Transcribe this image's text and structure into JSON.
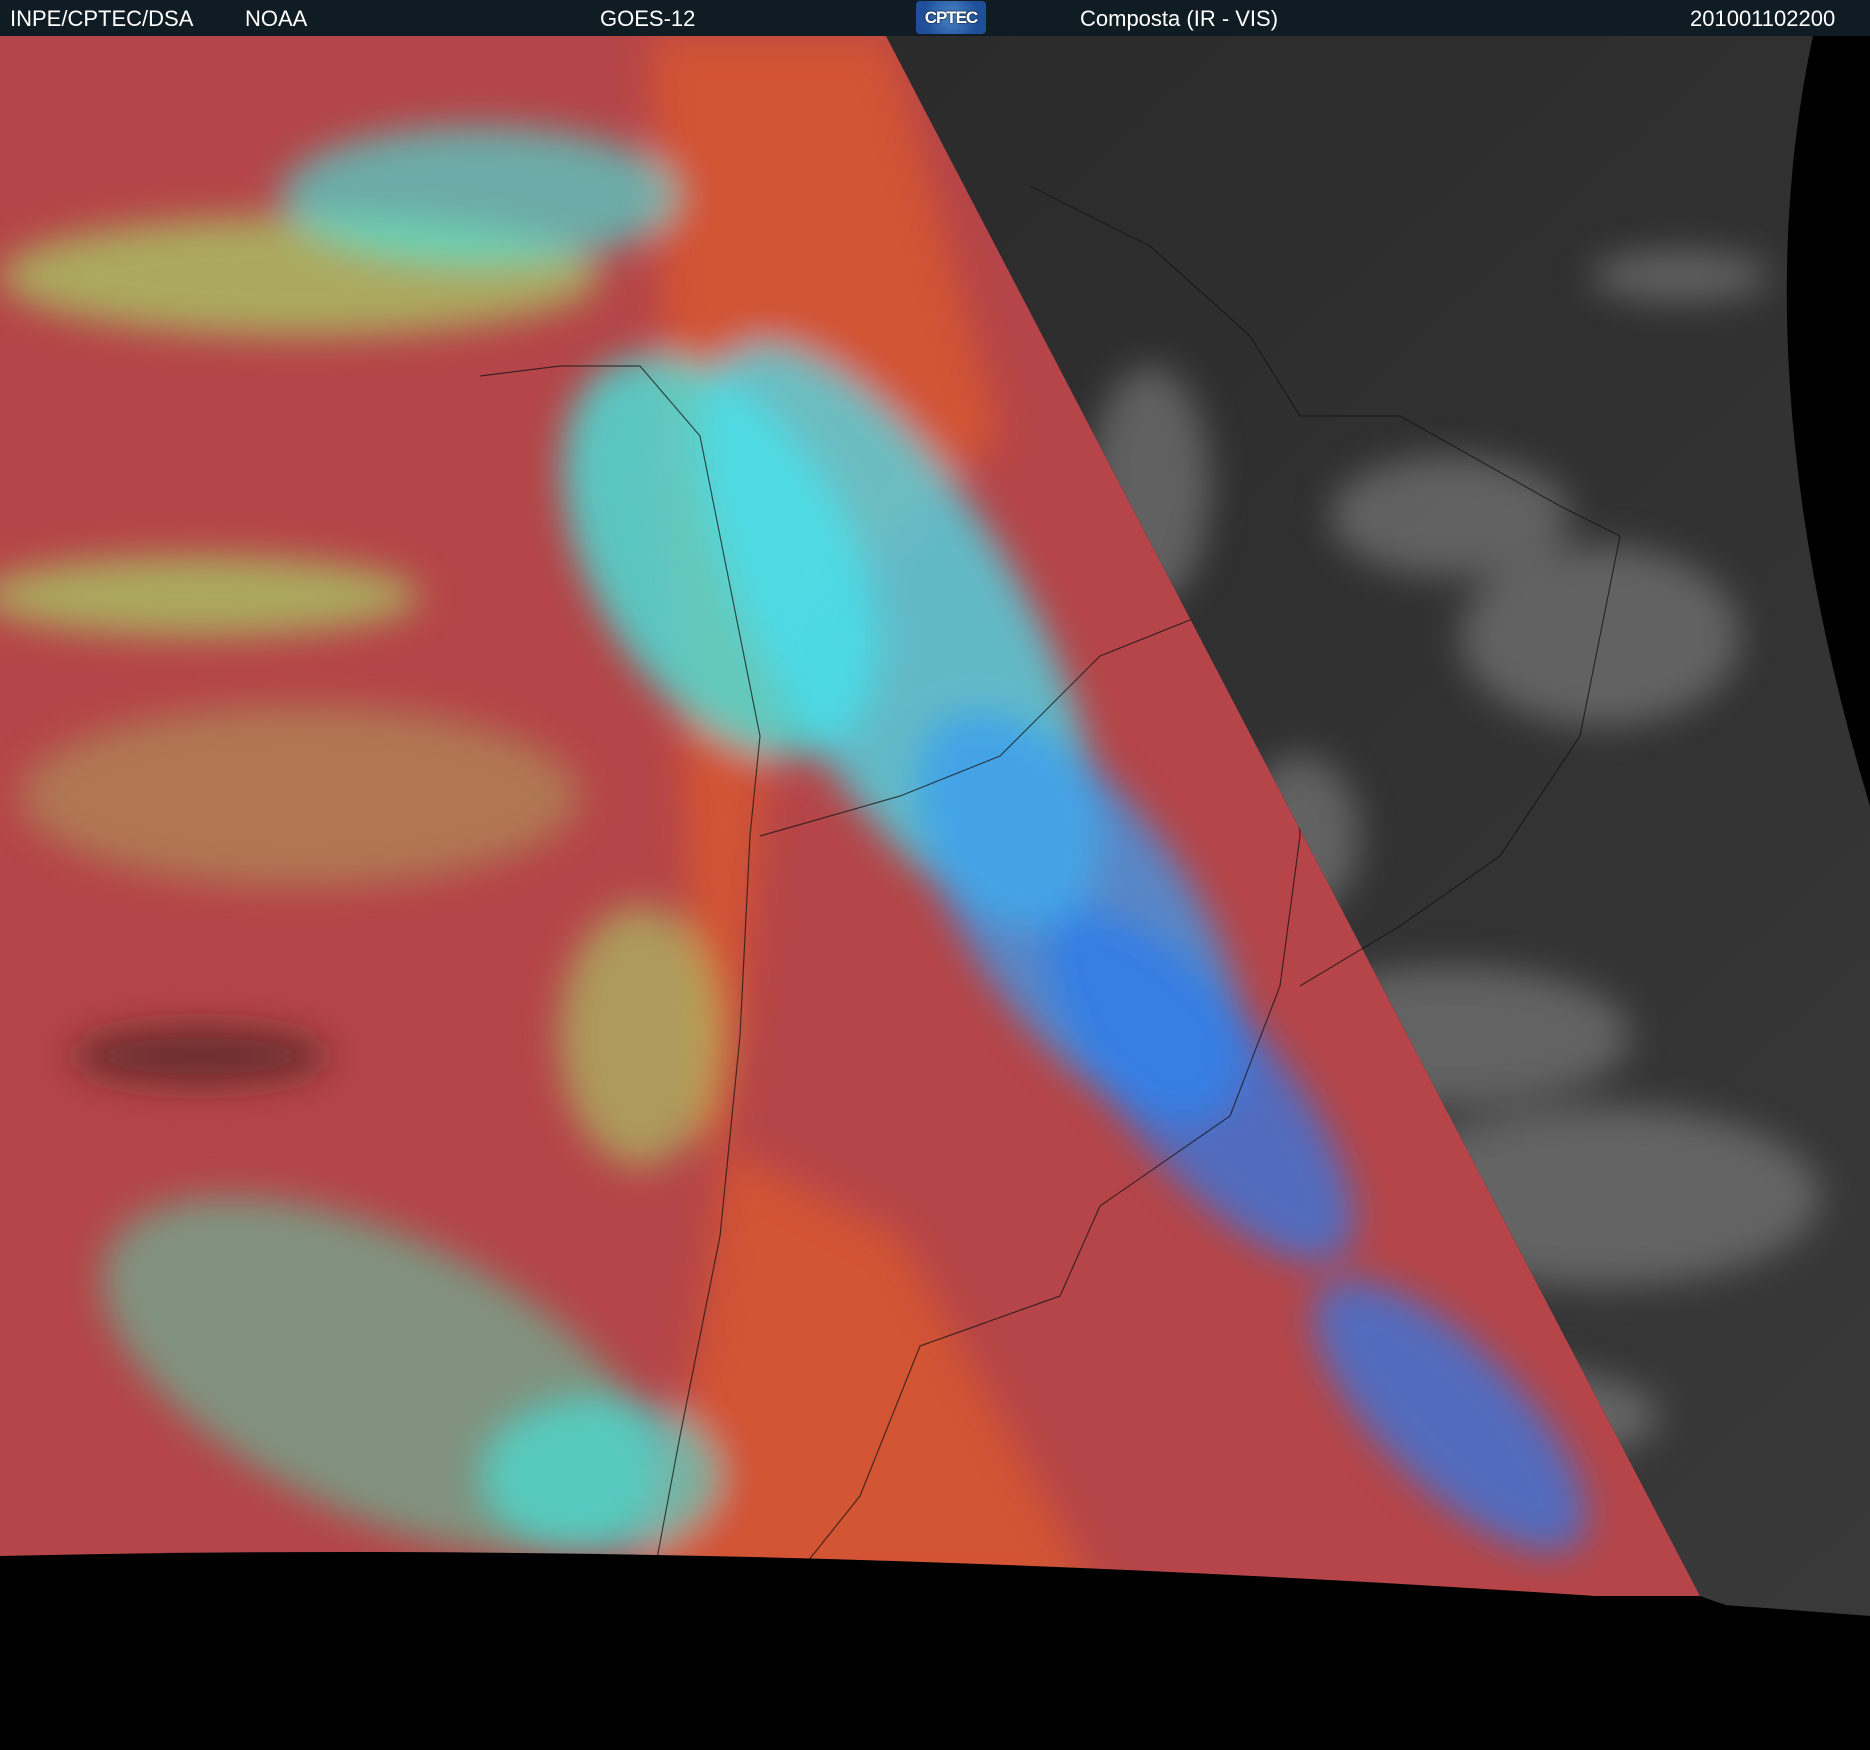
{
  "header": {
    "org": "INPE/CPTEC/DSA",
    "agency": "NOAA",
    "satellite": "GOES-12",
    "logo_text": "CPTEC",
    "product": "Composta (IR - VIS)",
    "timestamp": "201001102200"
  },
  "colors": {
    "header_bg": "#101c24",
    "ir_ocean": "#b54548",
    "ir_land": "#d9572e",
    "cloud_cyan": "#3ef0e8",
    "cloud_green": "#a8d46a",
    "cloud_blue": "#2a7cf0",
    "vis_gray": "#2e2e2e",
    "space": "#000000"
  }
}
